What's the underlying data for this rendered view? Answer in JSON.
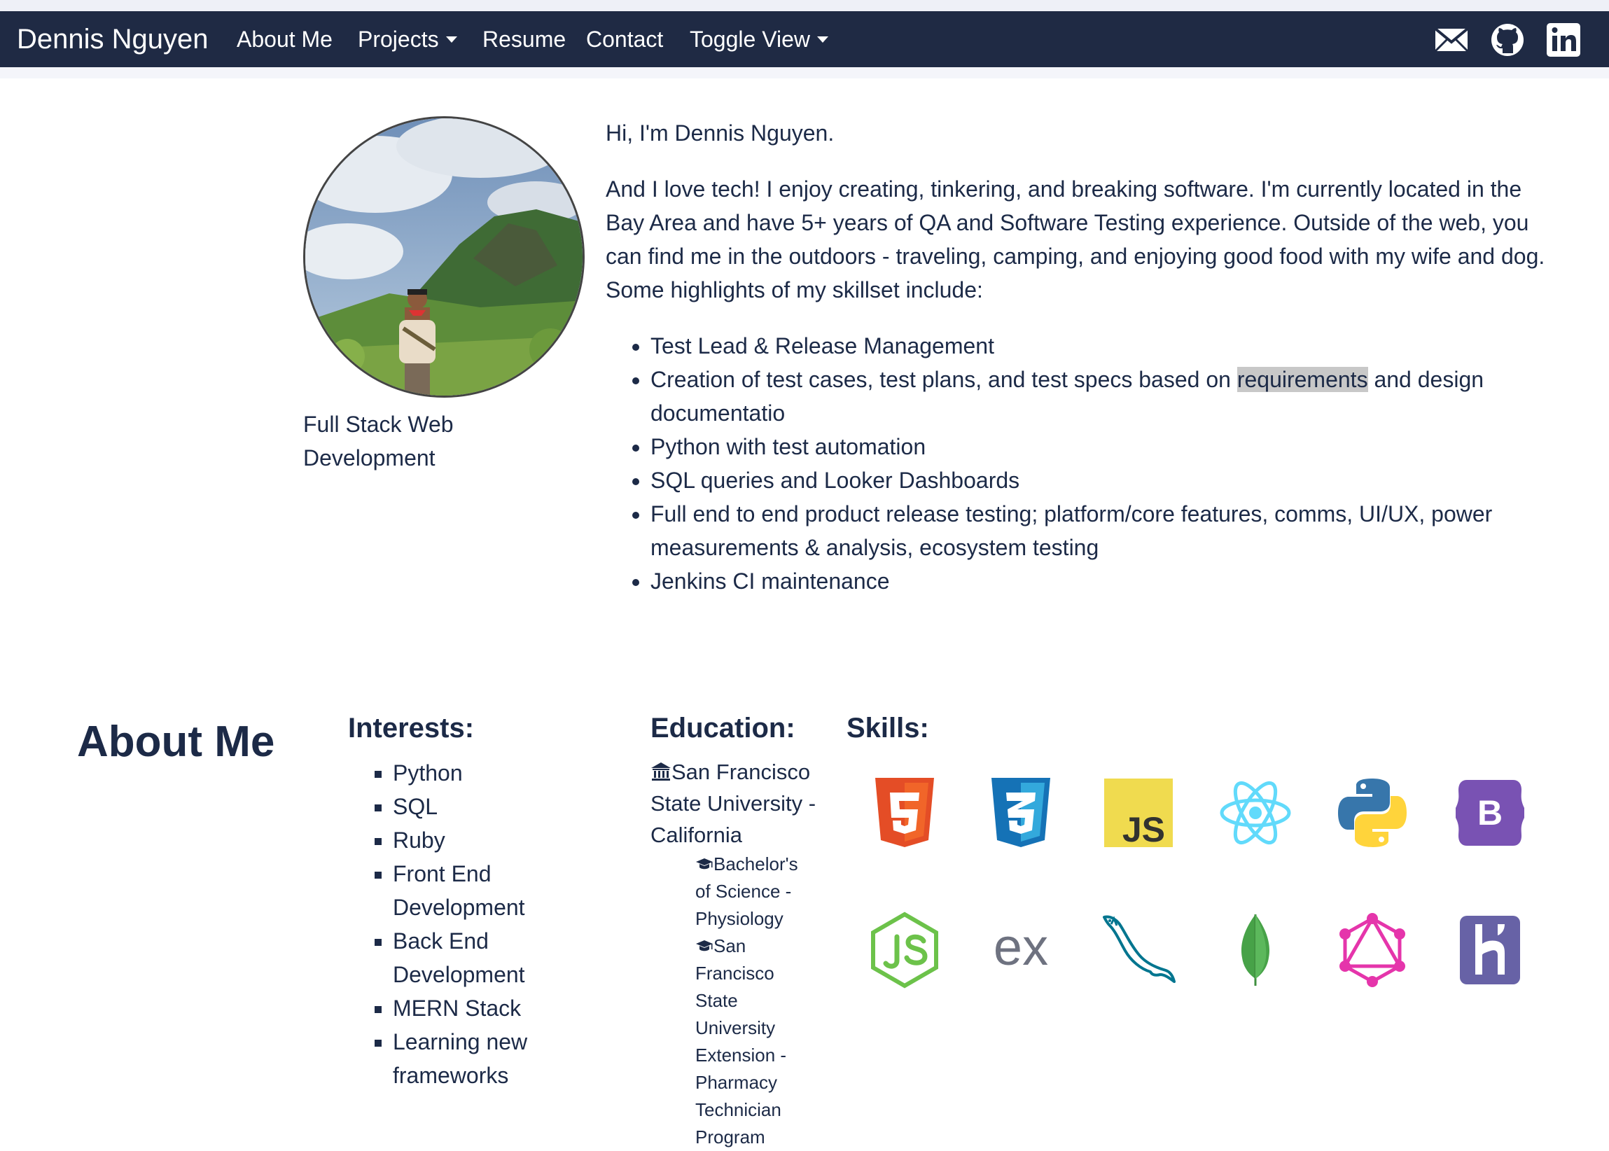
{
  "nav": {
    "brand": "Dennis Nguyen",
    "about": "About Me",
    "projects": "Projects",
    "resume": "Resume",
    "contact": "Contact",
    "toggle": "Toggle View"
  },
  "hero": {
    "caption": "Full Stack Web Development",
    "greeting": "Hi, I'm Dennis Nguyen.",
    "bio": "And I love tech! I enjoy creating, tinkering, and breaking software. I'm currently located in the Bay Area and have 5+ years of QA and Software Testing experience. Outside of the web, you can find me in the outdoors - traveling, camping, and enjoying good food with my wife and dog. Some highlights of my skillset include:",
    "skills_list": {
      "item0": "Test Lead & Release Management",
      "item1_before": "Creation of test cases, test plans, and test specs based on ",
      "item1_highlight": "requirements",
      "item1_after": " and design documentatio",
      "item2": "Python with test automation",
      "item3": "SQL queries and Looker Dashboards",
      "item4": "Full end to end product release testing; platform/core features, comms, UI/UX, power measurements & analysis, ecosystem testing",
      "item5": "Jenkins CI maintenance"
    }
  },
  "about": {
    "title": "About Me",
    "interests_title": "Interests:",
    "interests": [
      "Python",
      "SQL",
      "Ruby",
      "Front End Development",
      "Back End Development",
      "MERN Stack",
      "Learning new frameworks"
    ],
    "education_title": "Education:",
    "school": "San Francisco State University - California",
    "degree1": "Bachelor's of Science - Physiology",
    "degree2": "San Francisco State University Extension - Pharmacy Technician Program",
    "skills_title": "Skills:",
    "js_label": "JS",
    "ex_label": "ex",
    "bootstrap_label": "B"
  }
}
